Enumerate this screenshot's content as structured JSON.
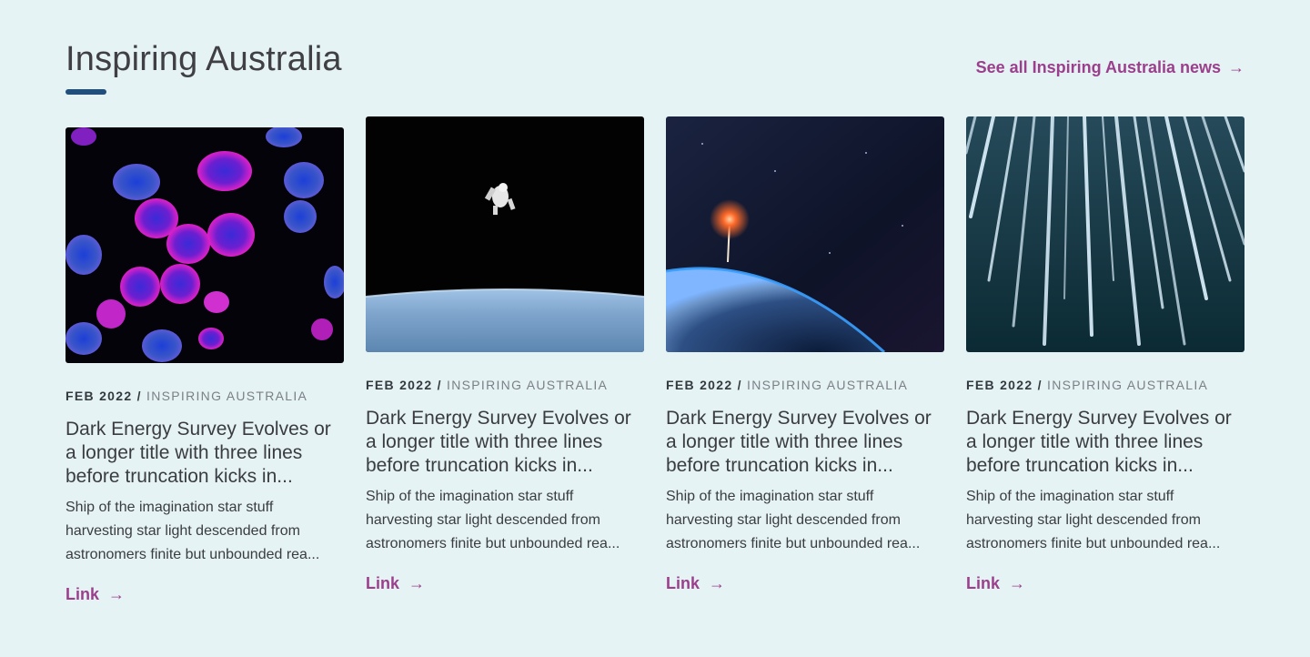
{
  "section": {
    "title": "Inspiring Australia",
    "see_all_label": "See all Inspiring Australia news",
    "see_all_arrow": "→"
  },
  "cards": [
    {
      "date": "FEB 2022",
      "separator": " / ",
      "category": "INSPIRING AUSTRALIA",
      "title": "Dark Energy Survey Evolves or a longer title with three lines before truncation kicks in...",
      "description": "Ship of the imagination star stuff harvesting star light descended from astronomers finite but unbounded rea...",
      "link_label": "Link",
      "link_arrow": "→",
      "image": "cells-microscopy-image"
    },
    {
      "date": "FEB 2022",
      "separator": " / ",
      "category": "INSPIRING AUSTRALIA",
      "title": "Dark Energy Survey Evolves or a longer title with three lines before truncation kicks in...",
      "description": "Ship of the imagination star stuff harvesting star light descended from astronomers finite but unbounded rea...",
      "link_label": "Link",
      "link_arrow": "→",
      "image": "astronaut-space-image"
    },
    {
      "date": "FEB 2022",
      "separator": " / ",
      "category": "INSPIRING AUSTRALIA",
      "title": "Dark Energy Survey Evolves or a longer title with three lines before truncation kicks in...",
      "description": "Ship of the imagination star stuff harvesting star light descended from astronomers finite but unbounded rea...",
      "link_label": "Link",
      "link_arrow": "→",
      "image": "earth-rocket-launch-image"
    },
    {
      "date": "FEB 2022",
      "separator": " / ",
      "category": "INSPIRING AUSTRALIA",
      "title": "Dark Energy Survey Evolves or a longer title with three lines before truncation kicks in...",
      "description": "Ship of the imagination star stuff harvesting star light descended from astronomers finite but unbounded rea...",
      "link_label": "Link",
      "link_arrow": "→",
      "image": "light-streaks-image"
    }
  ],
  "colors": {
    "background": "#e5f3f4",
    "accent": "#9b3f8c",
    "underline": "#1f4f7a",
    "text": "#3a3c42",
    "muted": "#7b8087"
  }
}
